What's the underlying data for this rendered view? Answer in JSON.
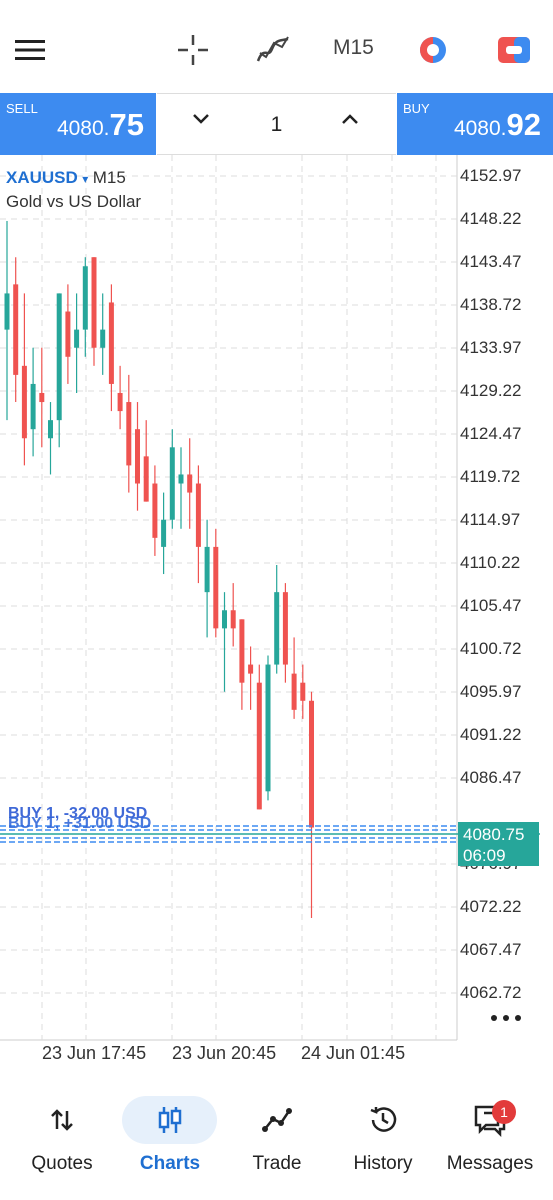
{
  "toolbar": {
    "menu_icon": "hamburger-menu-icon",
    "crosshair_icon": "crosshair-icon",
    "indicators_icon": "indicators-icon",
    "timeframe": "M15",
    "objects_icon": "objects-icon",
    "trade_toggle_icon": "one-click-trading-icon"
  },
  "trade": {
    "sell_label": "SELL",
    "sell_price_main": "4080.",
    "sell_price_big": "75",
    "volume": "1",
    "buy_label": "BUY",
    "buy_price_main": "4080.",
    "buy_price_big": "92"
  },
  "chart": {
    "symbol": "XAUUSD",
    "symbol_dropdown": "▾",
    "timeframe": "M15",
    "description": "Gold vs US Dollar",
    "price_axis": [
      "4152.97",
      "4148.22",
      "4143.47",
      "4138.72",
      "4133.97",
      "4129.22",
      "4124.47",
      "4119.72",
      "4114.97",
      "4110.22",
      "4105.47",
      "4100.72",
      "4095.97",
      "4091.22",
      "4086.47",
      "4076.97",
      "4072.22",
      "4067.47",
      "4062.72"
    ],
    "time_axis": [
      "23 Jun 17:45",
      "23 Jun 20:45",
      "24 Jun 01:45"
    ],
    "current_price": "4080.75",
    "countdown": "06:09",
    "position_label_1": "BUY 1, -32.00 USD",
    "position_label_2": "BUY 1, +31.00 USD",
    "more_icon": "more-dots-icon",
    "colors": {
      "bull": "#26a69a",
      "bear": "#ef5350",
      "accent": "#3d8bf0"
    }
  },
  "chart_data": {
    "type": "candlestick",
    "ylim": [
      4060,
      4155
    ],
    "candles": [
      {
        "o": 4136.0,
        "h": 4148.0,
        "l": 4126.0,
        "c": 4140.0
      },
      {
        "o": 4141.0,
        "h": 4144.0,
        "l": 4128.0,
        "c": 4131.0
      },
      {
        "o": 4132.0,
        "h": 4140.0,
        "l": 4121.0,
        "c": 4124.0
      },
      {
        "o": 4125.0,
        "h": 4134.0,
        "l": 4122.0,
        "c": 4130.0
      },
      {
        "o": 4129.0,
        "h": 4134.0,
        "l": 4123.0,
        "c": 4128.0
      },
      {
        "o": 4124.0,
        "h": 4128.0,
        "l": 4120.0,
        "c": 4126.0
      },
      {
        "o": 4126.0,
        "h": 4140.0,
        "l": 4123.0,
        "c": 4140.0
      },
      {
        "o": 4138.0,
        "h": 4141.0,
        "l": 4130.0,
        "c": 4133.0
      },
      {
        "o": 4134.0,
        "h": 4140.0,
        "l": 4129.0,
        "c": 4136.0
      },
      {
        "o": 4136.0,
        "h": 4144.0,
        "l": 4133.0,
        "c": 4143.0
      },
      {
        "o": 4144.0,
        "h": 4144.0,
        "l": 4132.0,
        "c": 4134.0
      },
      {
        "o": 4134.0,
        "h": 4140.0,
        "l": 4131.0,
        "c": 4136.0
      },
      {
        "o": 4139.0,
        "h": 4141.0,
        "l": 4127.0,
        "c": 4130.0
      },
      {
        "o": 4129.0,
        "h": 4132.0,
        "l": 4125.0,
        "c": 4127.0
      },
      {
        "o": 4128.0,
        "h": 4131.0,
        "l": 4118.0,
        "c": 4121.0
      },
      {
        "o": 4125.0,
        "h": 4128.0,
        "l": 4116.0,
        "c": 4119.0
      },
      {
        "o": 4122.0,
        "h": 4126.0,
        "l": 4117.0,
        "c": 4117.0
      },
      {
        "o": 4119.0,
        "h": 4121.0,
        "l": 4111.0,
        "c": 4113.0
      },
      {
        "o": 4112.0,
        "h": 4118.0,
        "l": 4109.0,
        "c": 4115.0
      },
      {
        "o": 4115.0,
        "h": 4125.0,
        "l": 4114.0,
        "c": 4123.0
      },
      {
        "o": 4119.0,
        "h": 4123.0,
        "l": 4114.0,
        "c": 4120.0
      },
      {
        "o": 4120.0,
        "h": 4124.0,
        "l": 4114.0,
        "c": 4118.0
      },
      {
        "o": 4119.0,
        "h": 4121.0,
        "l": 4108.0,
        "c": 4112.0
      },
      {
        "o": 4107.0,
        "h": 4115.0,
        "l": 4102.0,
        "c": 4112.0
      },
      {
        "o": 4112.0,
        "h": 4114.0,
        "l": 4102.0,
        "c": 4103.0
      },
      {
        "o": 4103.0,
        "h": 4107.0,
        "l": 4096.0,
        "c": 4105.0
      },
      {
        "o": 4105.0,
        "h": 4108.0,
        "l": 4101.0,
        "c": 4103.0
      },
      {
        "o": 4104.0,
        "h": 4104.0,
        "l": 4094.0,
        "c": 4097.0
      },
      {
        "o": 4099.0,
        "h": 4101.0,
        "l": 4094.0,
        "c": 4098.0
      },
      {
        "o": 4097.0,
        "h": 4099.0,
        "l": 4083.0,
        "c": 4083.0
      },
      {
        "o": 4085.0,
        "h": 4100.0,
        "l": 4084.0,
        "c": 4099.0
      },
      {
        "o": 4099.0,
        "h": 4110.0,
        "l": 4098.0,
        "c": 4107.0
      },
      {
        "o": 4107.0,
        "h": 4108.0,
        "l": 4097.0,
        "c": 4099.0
      },
      {
        "o": 4098.0,
        "h": 4102.0,
        "l": 4093.0,
        "c": 4094.0
      },
      {
        "o": 4097.0,
        "h": 4099.0,
        "l": 4093.0,
        "c": 4095.0
      },
      {
        "o": 4095.0,
        "h": 4096.0,
        "l": 4071.0,
        "c": 4081.0
      }
    ]
  },
  "nav": {
    "items": [
      {
        "label": "Quotes",
        "icon": "quotes-icon"
      },
      {
        "label": "Charts",
        "icon": "charts-icon"
      },
      {
        "label": "Trade",
        "icon": "trade-icon"
      },
      {
        "label": "History",
        "icon": "history-icon"
      },
      {
        "label": "Messages",
        "icon": "messages-icon"
      }
    ],
    "messages_badge": "1"
  }
}
